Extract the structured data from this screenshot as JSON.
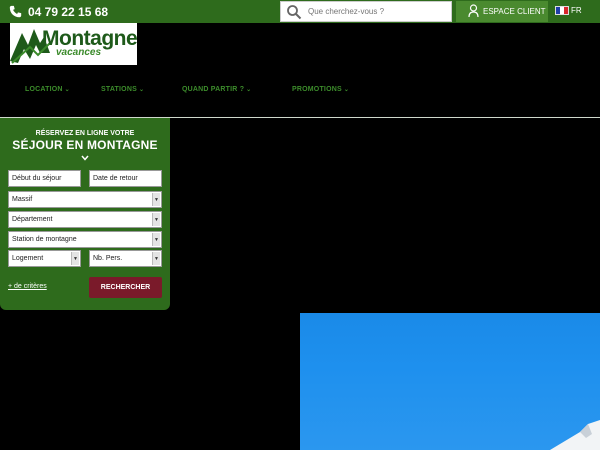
{
  "topbar": {
    "phone": "04 79 22 15 68",
    "search_placeholder": "Que cherchez-vous ?",
    "account_label": "ESPACE CLIENT",
    "language": "FR"
  },
  "logo": {
    "brand": "Montagne",
    "sub": "vacances"
  },
  "nav": {
    "items": [
      {
        "label": "LOCATION"
      },
      {
        "label": "STATIONS"
      },
      {
        "label": "QUAND PARTIR ?"
      },
      {
        "label": "PROMOTIONS"
      }
    ]
  },
  "booking": {
    "kicker": "RÉSERVEZ EN LIGNE VOTRE",
    "title": "SÉJOUR EN MONTAGNE",
    "start_date": "Début du séjour",
    "end_date": "Date de retour",
    "massif": "Massif",
    "departement": "Département",
    "station": "Station de montagne",
    "logement": "Logement",
    "persons": "Nb. Pers.",
    "more_criteria": "+ de critères",
    "search_button": "RECHERCHER"
  },
  "colors": {
    "green_dark": "#2e6b1c",
    "green_nav": "#3c8c2b",
    "button_red": "#7a1a2a",
    "sky_blue": "#1e90ee"
  }
}
